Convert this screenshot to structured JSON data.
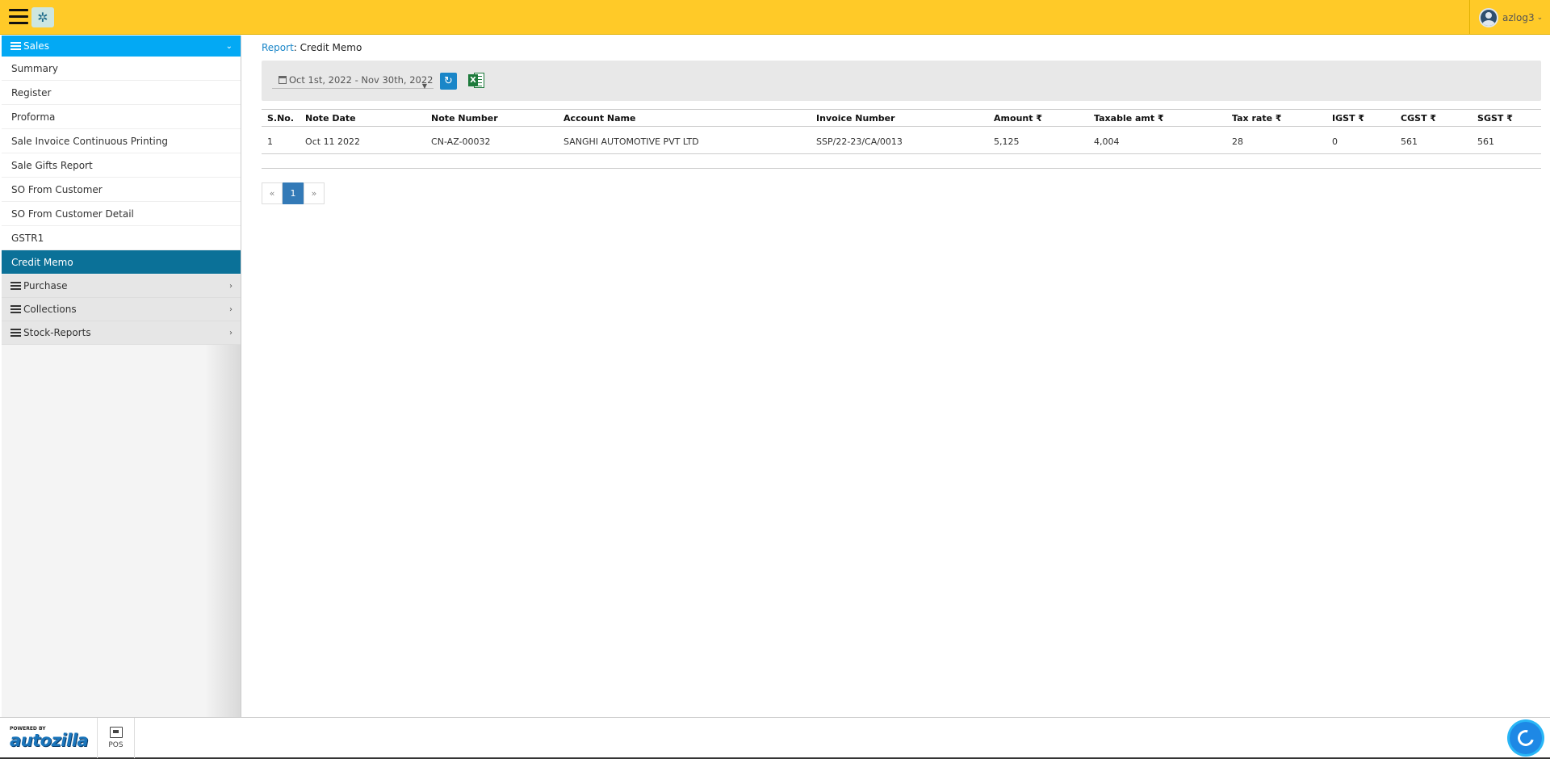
{
  "header": {
    "logo_icon": "company-logo-icon",
    "username": "azlog3"
  },
  "sidebar": {
    "sales_label": "Sales",
    "sales_items": [
      {
        "label": "Summary"
      },
      {
        "label": "Register"
      },
      {
        "label": "Proforma"
      },
      {
        "label": "Sale Invoice Continuous Printing"
      },
      {
        "label": "Sale Gifts Report"
      },
      {
        "label": "SO From Customer"
      },
      {
        "label": "SO From Customer Detail"
      },
      {
        "label": "GSTR1"
      },
      {
        "label": "Credit Memo"
      }
    ],
    "active_item": "Credit Memo",
    "sections": [
      {
        "label": "Purchase"
      },
      {
        "label": "Collections"
      },
      {
        "label": "Stock-Reports"
      }
    ]
  },
  "breadcrumb": {
    "link": "Report",
    "separator": ": ",
    "current": "Credit Memo"
  },
  "filters": {
    "date_range": "Oct 1st, 2022 - Nov 30th, 2022"
  },
  "table": {
    "columns": [
      "S.No.",
      "Note Date",
      "Note Number",
      "Account Name",
      "Invoice Number",
      "Amount ₹",
      "Taxable amt ₹",
      "Tax rate ₹",
      "IGST ₹",
      "CGST ₹",
      "SGST ₹"
    ],
    "rows": [
      [
        "1",
        "Oct 11 2022",
        "CN-AZ-00032",
        "SANGHI AUTOMOTIVE PVT LTD",
        "SSP/22-23/CA/0013",
        "5,125",
        "4,004",
        "28",
        "0",
        "561",
        "561"
      ]
    ]
  },
  "pagination": {
    "prev": "«",
    "current": "1",
    "next": "»"
  },
  "footer": {
    "powered_by": "POWERED BY",
    "brand": "autozilla",
    "pos_label": "POS"
  },
  "colors": {
    "topbar": "#ffca28",
    "sales_header": "#03a9f4",
    "active_item": "#0b7198",
    "link": "#1a86c8"
  }
}
